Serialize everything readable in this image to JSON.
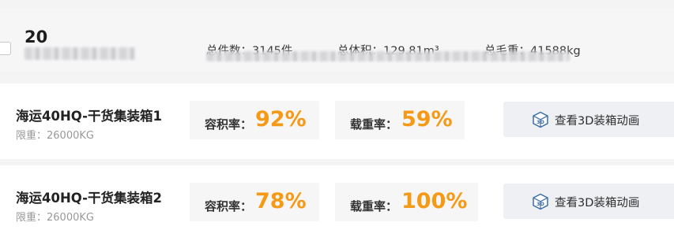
{
  "summary": {
    "number": "20",
    "stats": {
      "total_pieces": "总件数：3145件",
      "total_volume": "总体积：129.81m³",
      "total_gross_weight": "总毛重：41588kg"
    }
  },
  "containers": [
    {
      "name": "海运40HQ-干货集装箱1",
      "limit": "限重：26000KG",
      "volume_rate_label": "容积率：",
      "volume_rate": "92%",
      "load_rate_label": "载重率：",
      "load_rate": "59%",
      "view_3d_label": "查看3D装箱动画",
      "icon": "3d-box-icon"
    },
    {
      "name": "海运40HQ-干货集装箱2",
      "limit": "限重：26000KG",
      "volume_rate_label": "容积率：",
      "volume_rate": "78%",
      "load_rate_label": "载重率：",
      "load_rate": "100%",
      "view_3d_label": "查看3D装箱动画",
      "icon": "3d-box-icon"
    }
  ],
  "colors": {
    "accent": "#f59a16",
    "button_bg": "#eef0f4",
    "icon_blue": "#3d6ea8"
  }
}
